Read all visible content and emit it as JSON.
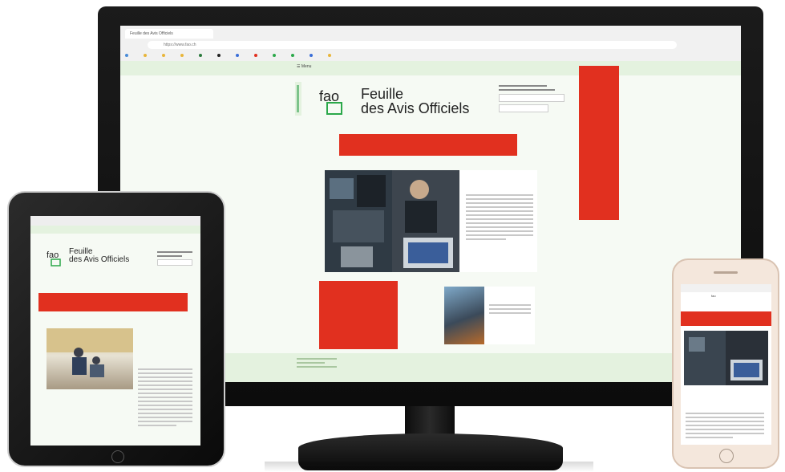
{
  "desktop": {
    "browser": {
      "tab_title": "Feuille des Avis Officiels",
      "url": "https://www.fao.ch",
      "bookmarks": [
        "",
        "",
        "",
        "",
        "",
        "",
        "",
        "",
        "",
        "",
        "",
        ""
      ]
    },
    "site": {
      "menu_label": "Menu",
      "nav_links": [
        "",
        "",
        "",
        ""
      ],
      "logo_mark": "fao",
      "logo_title_line1": "Feuille",
      "logo_title_line2": "des Avis Officiels",
      "footer_copyright": ""
    }
  },
  "tablet": {
    "logo_mark": "fao",
    "logo_title_line1": "Feuille",
    "logo_title_line2": "des Avis Officiels"
  },
  "phone": {
    "logo_mark": "fao"
  },
  "colors": {
    "accent_red": "#e1301f",
    "brand_green": "#2b7a3d",
    "light_green": "#e4f2df"
  }
}
